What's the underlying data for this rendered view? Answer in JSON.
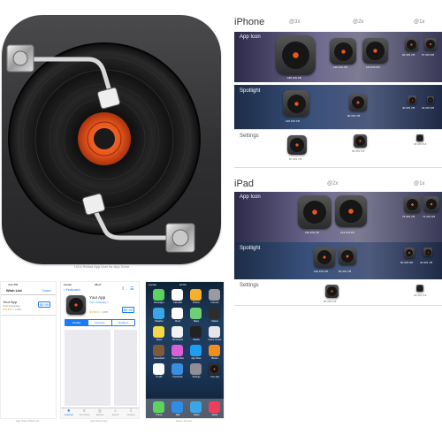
{
  "big_icon": {
    "caption": "1024 Retina App Icon for App Store"
  },
  "iphone": {
    "title": "iPhone",
    "columns": [
      "@3x",
      "@2x",
      "@1x"
    ],
    "rows": [
      {
        "label": "App Icon",
        "captions": [
          "180 iOS 7/8",
          "120 iOS 7/8",
          "114 iOS 5/6",
          "60 iOS 7/8",
          "57 iOS 5/6"
        ]
      },
      {
        "label": "Spotlight",
        "captions": [
          "120 iOS 7/8",
          "80 iOS 7/8",
          "40 iOS 7/8",
          "29 iOS 5/6"
        ]
      },
      {
        "label": "Settings",
        "captions": [
          "87 iOS 7/8",
          "58 iOS 5-8",
          "29 iOS 5-8"
        ]
      }
    ]
  },
  "ipad": {
    "title": "iPad",
    "columns": [
      "@2x",
      "@1x"
    ],
    "rows": [
      {
        "label": "App Icon",
        "captions": [
          "152 iOS 7/8",
          "144 iOS 5/6",
          "76 iOS 7/8",
          "72 iOS 5/6"
        ]
      },
      {
        "label": "Spotlight",
        "captions": [
          "100 iOS 7/8",
          "80 iOS 7/8",
          "50 iOS 5/6",
          "40 iOS 7/8"
        ]
      },
      {
        "label": "Settings",
        "captions": [
          "58 iOS 5-8",
          "29 iOS 5-8"
        ]
      }
    ]
  },
  "wishlist": {
    "time": "4:21 PM",
    "title": "Wish List",
    "done": "Done",
    "app_name": "Your App",
    "app_dev": "Your Company",
    "price": "$0.99",
    "reviews": "(187)",
    "caption": "App Store Wish List"
  },
  "appstore": {
    "carrier": "Carrier",
    "time": "08:27",
    "back": "Featured",
    "app_name": "Your App",
    "app_dev": "Your Company >",
    "reviews": "(187)",
    "price": "$0.99",
    "segments": [
      "Details",
      "Reviews",
      "Related"
    ],
    "tabs": [
      "Featured",
      "Top Charts",
      "Explore",
      "Search",
      "Updates"
    ],
    "caption": "App Store App"
  },
  "home": {
    "carrier": "Carrier",
    "time": "10:53",
    "apps": [
      "Messages",
      "Calendar",
      "Photos",
      "Camera",
      "Weather",
      "Clock",
      "Maps",
      "Videos",
      "Notes",
      "Reminders",
      "Stocks",
      "Game Center",
      "Newsstand",
      "iTunes Store",
      "App Store",
      "iBooks",
      "Health",
      "Passbook",
      "Settings",
      "Your App"
    ],
    "dock": [
      "Phone",
      "Mail",
      "Safari",
      "Music"
    ],
    "caption": "Home Screen"
  },
  "colors": {
    "accent": "#e8561e",
    "ios_blue": "#1a7cf5"
  }
}
